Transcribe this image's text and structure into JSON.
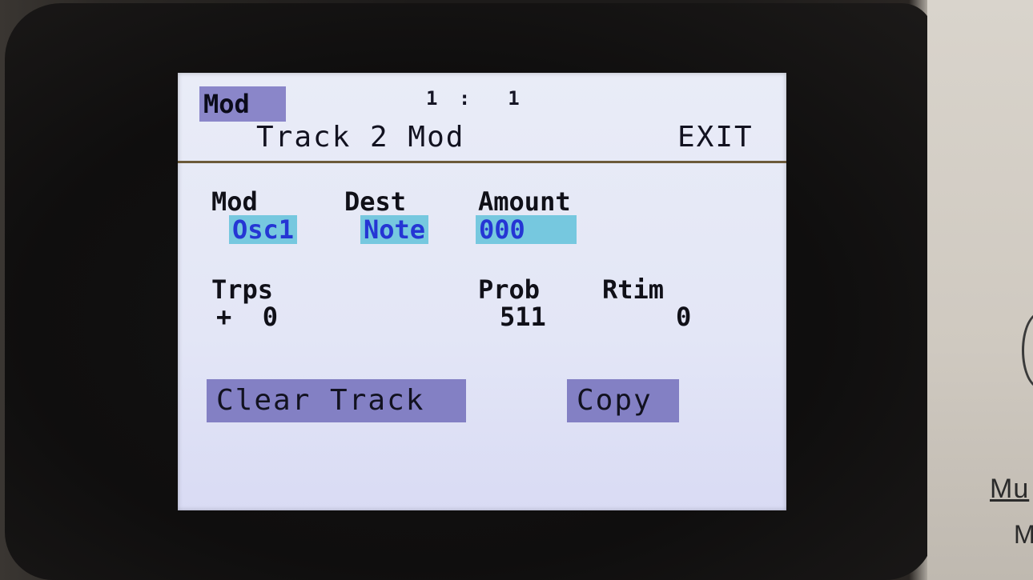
{
  "header": {
    "mode_tag": "Mod",
    "position": "1 :  1",
    "title": "Track 2 Mod",
    "exit_label": "EXIT"
  },
  "mod_section": {
    "labels": {
      "mod": "Mod",
      "dest": "Dest",
      "amount": "Amount"
    },
    "values": {
      "mod": "Osc1",
      "dest": "Note",
      "amount": "000"
    }
  },
  "track_section": {
    "labels": {
      "trps": "Trps",
      "prob": "Prob",
      "rtim": "Rtim"
    },
    "values": {
      "trps": "+  0",
      "prob": "511",
      "rtim": "0"
    }
  },
  "buttons": {
    "clear_track": "Clear Track",
    "copy": "Copy"
  },
  "device_panel": {
    "label_top": "Mu",
    "label_bottom": "M"
  },
  "colors": {
    "screen_bg": "#e3e6f6",
    "button_bg": "#8380c4",
    "highlight_bg": "#76c8df",
    "highlight_text": "#2536d4"
  }
}
